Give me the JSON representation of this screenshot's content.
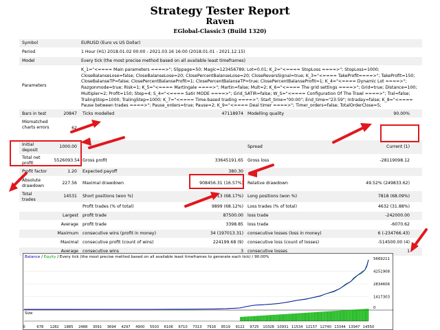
{
  "header": {
    "title": "Strategy Tester Report",
    "subtitle": "Raven",
    "build": "EGlobal-Classic3 (Build 1320)"
  },
  "info": {
    "symbol_label": "Symbol",
    "symbol": "EURUSD (Euro vs US Dollar)",
    "period_label": "Period",
    "period": "1 Hour (H1) 2018.01.02 00:00 - 2021.03.16 16:00 (2018.01.01 - 2021.12.15)",
    "model_label": "Model",
    "model": "Every tick (the most precise method based on all available least timeframes)",
    "parameters_label": "Parameters",
    "parameters": "K_1=\"<==== Main parameters ====>\"; Slippage=50; Magic=123456789; Lot=0.01; K_2=\"<==== StopLoss ====>\"; StopLoss=1000; CloseBalanseLose=false; CloseBalanseLose=20; ClosePercentBalanseLose=20; CloseReversSignal=true; K_3=\"<==== TakeProfit====>\"; TakeProfit=150; CloseBalanseTP=false; ClosePercentBalanseProfit=1; ClosePercentBalanseTP=true; ClosePercentBalanseProfit=1; K_4=\"<==== Dynamic Lot ====>\"; Razgonmode=true; Risk=1; K_5=\"<==== Martingale ====>\"; Martin=false; Mult=2; K_6=\"<==== The grid settings ====>\"; Grid=true; Distance=100; Multipler=2; Profit=150; Step=4; S_4=\"<==== Satir MODE ====>\"; Grid_SATIR=false; W_S=\"<==== Configuration Of The Trawl ====>\"; Tral=false; TralingStop=1000; TralingStep=1000; K_7=\"<==== Time-based trading ====>\"; Start_time=\"00:00\"; End_time=\"23:59\"; Intraday=false; K_8=\"<==== Pause between trades ====>\"; Pause_orders=true; Pause=2; K_9=\"<==== Deal timer ====>\"; Timer_orders=false; TotalOrderClose=5;"
  },
  "stats": {
    "bars_label": "Bars in test",
    "bars": "20847",
    "ticks_label": "Ticks modelled",
    "ticks": "47118974",
    "quality_label": "Modelling quality",
    "quality": "90.00%",
    "mismatch_label": "Mismatched charts errors",
    "mismatch": "62",
    "initial_label": "Initial deposit",
    "initial": "1000.00",
    "spread_label": "Spread",
    "spread": "Current (1)",
    "net_label": "Total net profit",
    "net": "5526093.54",
    "gross_profit_label": "Gross profit",
    "gross_profit": "33645191.65",
    "gross_loss_label": "Gross loss",
    "gross_loss": "-28119098.12",
    "pf_label": "Profit factor",
    "pf": "1.20",
    "payoff_label": "Expected payoff",
    "payoff": "380.30",
    "abs_dd_label": "Absolute drawdown",
    "abs_dd": "227.56",
    "max_dd_label": "Maximal drawdown",
    "max_dd": "908456.31 (16.57%)",
    "rel_dd_label": "Relative drawdown",
    "rel_dd": "49.52% (249833.62)",
    "trades_label": "Total trades",
    "trades": "14531",
    "short_label": "Short positions (won %)",
    "short": "6713 (68.17%)",
    "long_label": "Long positions (won %)",
    "long": "7818 (68.09%)",
    "pt_label": "Profit trades (% of total)",
    "pt": "9899 (68.12%)",
    "lt_label": "Loss trades (% of total)",
    "lt": "4632 (31.88%)",
    "largest_label": "Largest",
    "largest_pt_label": "profit trade",
    "largest_pt": "87500.00",
    "largest_lt_label": "loss trade",
    "largest_lt": "-242000.00",
    "average_label": "Average",
    "average_pt_label": "profit trade",
    "average_pt": "3398.85",
    "average_lt_label": "loss trade",
    "average_lt": "-6070.62",
    "maximum_label": "Maximum",
    "max_cw_label": "consecutive wins (profit in money)",
    "max_cw": "34 (197013.31)",
    "max_cl_label": "consecutive losses (loss in money)",
    "max_cl": "6 (-234766.43)",
    "maximal_label": "Maximal",
    "mx_cp_label": "consecutive profit (count of wins)",
    "mx_cp": "224199.68 (9)",
    "mx_cl_label": "consecutive loss (count of losses)",
    "mx_cl": "-514500.00 (4)",
    "avg_label": "Average",
    "avg_cw_label": "consecutive wins",
    "avg_cw": "3",
    "avg_cl_label": "consecutive losses",
    "avg_cl": "1"
  },
  "chart_data": {
    "type": "line",
    "caption": {
      "balance": "Balance",
      "sep": " / ",
      "equity": "Equity",
      "rest": " / Every tick (the most precise method based on all available least timeframes to generate each tick) / 90.00%"
    },
    "size_label": "Size",
    "series_colors": {
      "balance": "#0000aa",
      "equity": "#00a000",
      "size": "#00b000"
    },
    "ylim": [
      0,
      5669211
    ],
    "y_ticks": [
      "5669211",
      "4251908",
      "2834606",
      "1417303",
      "0"
    ],
    "x_ticks": [
      "0",
      "678",
      "1282",
      "1885",
      "2488",
      "3091",
      "3694",
      "4297",
      "4900",
      "5503",
      "6106",
      "6710",
      "7313",
      "7916",
      "8519",
      "9122",
      "9725",
      "10328",
      "10931",
      "11534",
      "12137",
      "12740",
      "13344",
      "13947",
      "14550"
    ],
    "x_max": 14550,
    "balance": [
      [
        0,
        0
      ],
      [
        1885,
        2000
      ],
      [
        3694,
        5000
      ],
      [
        5503,
        9000
      ],
      [
        6710,
        14000
      ],
      [
        7313,
        20000
      ],
      [
        7916,
        40000
      ],
      [
        8519,
        80000
      ],
      [
        9122,
        160000
      ],
      [
        9400,
        320000
      ],
      [
        9725,
        470000
      ],
      [
        10100,
        520000
      ],
      [
        10328,
        560000
      ],
      [
        10700,
        640000
      ],
      [
        10931,
        720000
      ],
      [
        11300,
        900000
      ],
      [
        11534,
        1010000
      ],
      [
        11900,
        1150000
      ],
      [
        12137,
        1280000
      ],
      [
        12500,
        1500000
      ],
      [
        12740,
        1720000
      ],
      [
        13100,
        2040000
      ],
      [
        13344,
        2320000
      ],
      [
        13600,
        2830000
      ],
      [
        13800,
        3100000
      ],
      [
        13947,
        3540000
      ],
      [
        14100,
        3820000
      ],
      [
        14250,
        4120000
      ],
      [
        14400,
        4400000
      ],
      [
        14480,
        4900000
      ],
      [
        14550,
        5526000
      ]
    ]
  },
  "colors": {
    "accent": "#e0171d",
    "row_shade": "#f0f0f0"
  }
}
